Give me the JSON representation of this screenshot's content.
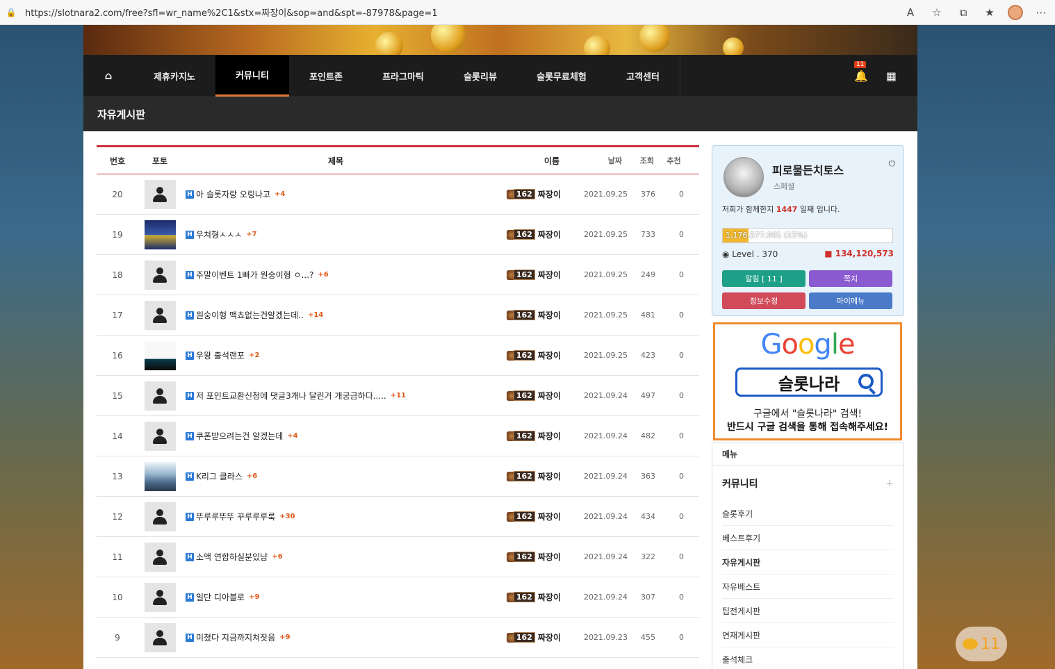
{
  "browser": {
    "url": "https://slotnara2.com/free?sfl=wr_name%2C1&stx=짜장이&sop=and&spt=-87978&page=1",
    "icons": [
      "lock-icon",
      "reader-icon",
      "favorite-icon",
      "extensions-icon",
      "favorites-icon",
      "profile-icon",
      "more-icon"
    ]
  },
  "nav": {
    "home": "⌂",
    "items": [
      "제휴카지노",
      "커뮤니티",
      "포인트존",
      "프라그마틱",
      "슬롯리뷰",
      "슬롯무료체험",
      "고객센터"
    ],
    "active_index": 1,
    "bell_badge": "11"
  },
  "subheader": {
    "title": "자유게시판"
  },
  "board": {
    "headers": {
      "num": "번호",
      "photo": "포토",
      "title": "제목",
      "name": "이름",
      "date": "날짜",
      "views": "조회",
      "rec": "추천"
    },
    "rows": [
      {
        "num": "20",
        "thumb": "default",
        "title": "아 슬롯자랑 오링나고",
        "comments": "+4",
        "level": "162",
        "name": "짜장이",
        "date": "2021.09.25",
        "views": "376",
        "rec": "0"
      },
      {
        "num": "19",
        "thumb": "photo1",
        "title": "우쳐형ㅅㅅㅅ",
        "comments": "+7",
        "level": "162",
        "name": "짜장이",
        "date": "2021.09.25",
        "views": "733",
        "rec": "0"
      },
      {
        "num": "18",
        "thumb": "default",
        "title": "주말이벤트 1빠가 원숭이형 ㅇ...?",
        "comments": "+6",
        "level": "162",
        "name": "짜장이",
        "date": "2021.09.25",
        "views": "249",
        "rec": "0"
      },
      {
        "num": "17",
        "thumb": "default",
        "title": "원숭이형 맥쵸없는건알겠는데..",
        "comments": "+14",
        "level": "162",
        "name": "짜장이",
        "date": "2021.09.25",
        "views": "481",
        "rec": "0"
      },
      {
        "num": "16",
        "thumb": "photo2",
        "title": "우왕 출석랜포",
        "comments": "+2",
        "level": "162",
        "name": "짜장이",
        "date": "2021.09.25",
        "views": "423",
        "rec": "0"
      },
      {
        "num": "15",
        "thumb": "default",
        "title": "저 포인트교환신청에 댓글3개나 달린거 개궁금하다.....",
        "comments": "+11",
        "level": "162",
        "name": "짜장이",
        "date": "2021.09.24",
        "views": "497",
        "rec": "0"
      },
      {
        "num": "14",
        "thumb": "default",
        "title": "쿠폰받으려는건 알겠는데",
        "comments": "+4",
        "level": "162",
        "name": "짜장이",
        "date": "2021.09.24",
        "views": "482",
        "rec": "0"
      },
      {
        "num": "13",
        "thumb": "photo3",
        "title": "K리그 클라스",
        "comments": "+6",
        "level": "162",
        "name": "짜장이",
        "date": "2021.09.24",
        "views": "363",
        "rec": "0"
      },
      {
        "num": "12",
        "thumb": "default",
        "title": "뚜루루뚜뚜 꾸루루루룩",
        "comments": "+30",
        "level": "162",
        "name": "짜장이",
        "date": "2021.09.24",
        "views": "434",
        "rec": "0"
      },
      {
        "num": "11",
        "thumb": "default",
        "title": "소액 연합하실분있냠",
        "comments": "+6",
        "level": "162",
        "name": "짜장이",
        "date": "2021.09.24",
        "views": "322",
        "rec": "0"
      },
      {
        "num": "10",
        "thumb": "default",
        "title": "일단 디아블로",
        "comments": "+9",
        "level": "162",
        "name": "짜장이",
        "date": "2021.09.24",
        "views": "307",
        "rec": "0"
      },
      {
        "num": "9",
        "thumb": "default",
        "title": "미쳤다 지금까지쳐잣음",
        "comments": "+9",
        "level": "162",
        "name": "짜장이",
        "date": "2021.09.23",
        "views": "455",
        "rec": "0"
      }
    ]
  },
  "profile": {
    "nickname": "피로물든치토스",
    "grade": "스페셜",
    "days_prefix": "저희가 함께한지 ",
    "days": "1447",
    "days_suffix": " 일째 입니다.",
    "xp_text": "1,176,577,001 (15%)",
    "xp_fraction": 0.15,
    "level": "Level . 370",
    "points": "134,120,573",
    "buttons": {
      "alarm": "알림 [ 11 ]",
      "memo": "쪽지",
      "edit": "정보수정",
      "mymenu": "마이메뉴"
    }
  },
  "google_ad": {
    "logo": "Google",
    "search_text": "슬롯나라",
    "line1": "구글에서 \"슬롯나라\" 검색!",
    "line2": "반드시 구글 검색을 통해 접속해주세요!"
  },
  "menu": {
    "header": "메뉴",
    "category": "커뮤니티",
    "plus": "+",
    "items": [
      "슬롯후기",
      "베스트후기",
      "자유게시판",
      "자유베스트",
      "팁전게시판",
      "연재게시판",
      "출석체크"
    ],
    "current_index": 2
  },
  "chat_float": {
    "count": "11"
  },
  "colors": {
    "accent": "#e07a30",
    "board_line": "#c83038",
    "comment": "#e05a1a",
    "points": "#d0302a"
  }
}
